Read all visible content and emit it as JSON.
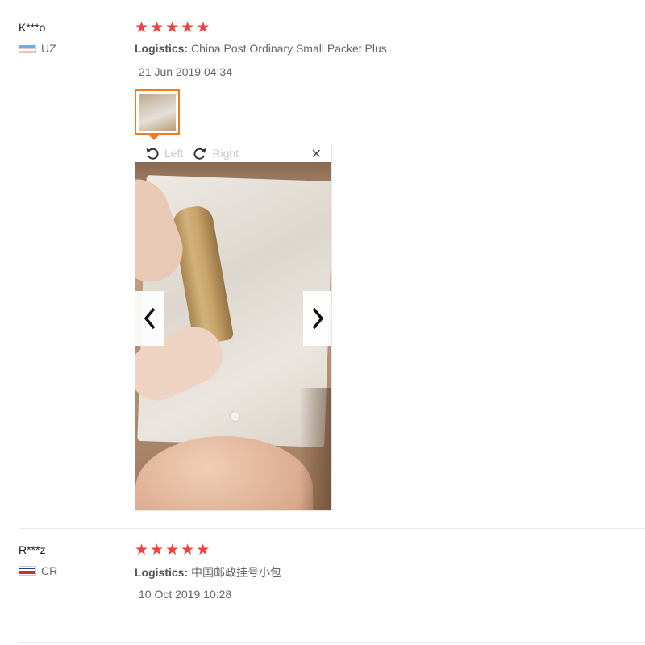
{
  "reviews": [
    {
      "user": "K***o",
      "country_code": "UZ",
      "rating": 5,
      "logistics_label": "Logistics:",
      "logistics_value": "China Post Ordinary Small Packet Plus",
      "date": "21 Jun 2019 04:34",
      "viewer": {
        "rotate_left_label": "Left",
        "rotate_right_label": "Right",
        "close_glyph": "✕"
      }
    },
    {
      "user": "R***z",
      "country_code": "CR",
      "rating": 5,
      "logistics_label": "Logistics:",
      "logistics_value": "中国邮政挂号小包",
      "date": "10 Oct 2019 10:28"
    }
  ],
  "star_glyph": "★",
  "colors": {
    "star": "#f0413f",
    "accent": "#f27a21"
  },
  "icons": [
    "flag-uz-icon",
    "rotate-left-icon",
    "rotate-right-icon",
    "close-icon",
    "chevron-left-icon",
    "chevron-right-icon",
    "flag-cr-icon"
  ]
}
